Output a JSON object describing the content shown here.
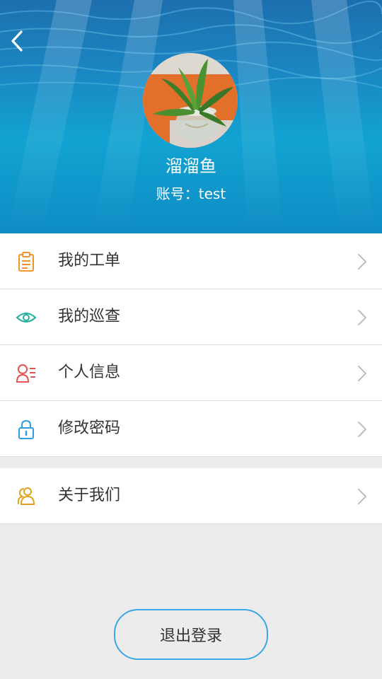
{
  "profile": {
    "name": "溜溜鱼",
    "account": "账号：test"
  },
  "menu": {
    "work_orders": "我的工单",
    "inspections": "我的巡查",
    "personal_info": "个人信息",
    "change_password": "修改密码",
    "about_us": "关于我们"
  },
  "logout_label": "退出登录",
  "colors": {
    "accent": "#3aa7e6",
    "icon_orange": "#f0952e",
    "icon_teal": "#1fae9a",
    "icon_red": "#e8514f",
    "icon_blue": "#2f9fe0",
    "icon_gold": "#e0a21e"
  },
  "icons": {
    "back": "chevron-left-icon",
    "work_orders": "clipboard-icon",
    "inspections": "eye-icon",
    "personal_info": "user-card-icon",
    "change_password": "lock-icon",
    "about_us": "users-icon"
  }
}
